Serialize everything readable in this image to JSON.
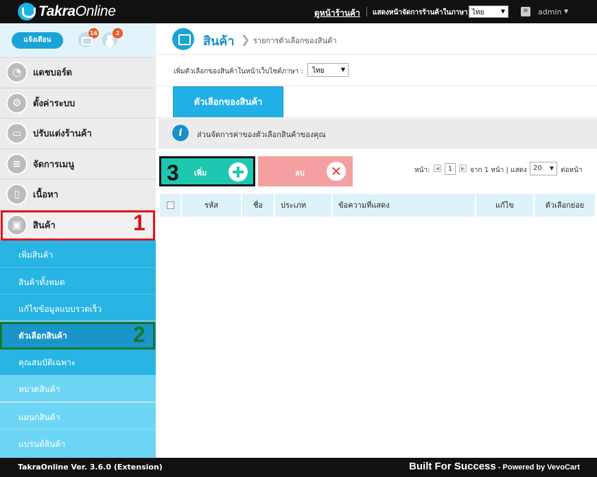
{
  "topbar": {
    "logo_bold": "Takra",
    "logo_rest": "Online",
    "storefront_link": "ดูหน้าร้านค้า",
    "lang_label": "แสดงหน้าจัดการร้านค้าในภาษา",
    "lang_value": "ไทย",
    "user": "admin"
  },
  "sidebar": {
    "notify_button": "แจ้งเตือน",
    "cart_badge": "16",
    "people_badge": "2",
    "menu": [
      {
        "label": "แดชบอร์ด",
        "icon": "dashboard-icon"
      },
      {
        "label": "ตั้งค่าระบบ",
        "icon": "gears-icon"
      },
      {
        "label": "ปรับแต่งร้านค้า",
        "icon": "monitor-icon"
      },
      {
        "label": "จัดการเมนู",
        "icon": "menu-list-icon"
      },
      {
        "label": "เนื้อหา",
        "icon": "document-icon"
      },
      {
        "label": "สินค้า",
        "icon": "box-icon"
      }
    ],
    "submenu": [
      {
        "label": "เพิ่มสินค้า",
        "color": "#28b5e4"
      },
      {
        "label": "สินค้าทั้งหมด",
        "color": "#28b5e4"
      },
      {
        "label": "แก้ไขข้อมูลแบบรวดเร็ว",
        "color": "#28b5e4"
      },
      {
        "label": "ตัวเลือกสินค้า",
        "color": "#1a95c9"
      },
      {
        "label": "คุณสมบัติเฉพาะ",
        "color": "#28b5e4"
      },
      {
        "label": "หมวดสินค้า",
        "color": "#6ed6f5"
      },
      {
        "label": "แผนกสินค้า",
        "color": "#6ed6f5"
      },
      {
        "label": "แบรนด์สินค้า",
        "color": "#6ed6f5"
      }
    ],
    "annotation_1": "1",
    "annotation_2": "2"
  },
  "header": {
    "title": "สินค้า",
    "chevron": "❯",
    "breadcrumb": "รายการตัวเลือกของสินค้า"
  },
  "lang_row": {
    "label": "เพิ่มตัวเลือกของสินค้าในหน้าเว็บไซต์ภาษา :",
    "value": "ไทย"
  },
  "tab": {
    "label": "ตัวเลือกของสินค้า"
  },
  "info": {
    "text": "ส่วนจัดการค่าของตัวเลือกสินค้าของคุณ",
    "icon_glyph": "i"
  },
  "toolbar": {
    "annotation_3": "3",
    "add_label": "เพิ่ม",
    "delete_label": "ลบ",
    "delete_glyph": "✕"
  },
  "pager": {
    "page_label": "หน้า:",
    "page": "1",
    "of_text": "จาก 1 หน้า | แสดง",
    "per_page": "20",
    "per_page_suffix": "ต่อหน้า"
  },
  "table": {
    "columns": [
      "รหัส",
      "ชื่อ",
      "ประเภท",
      "ข้อความที่แสดง",
      "แก้ไข",
      "ตัวเลือกย่อย"
    ]
  },
  "footer": {
    "version": "TakraOnline Ver. 3.6.0 (Extension)",
    "tagline": "Built For Success",
    "powered": " - Powered by VevoCart"
  }
}
